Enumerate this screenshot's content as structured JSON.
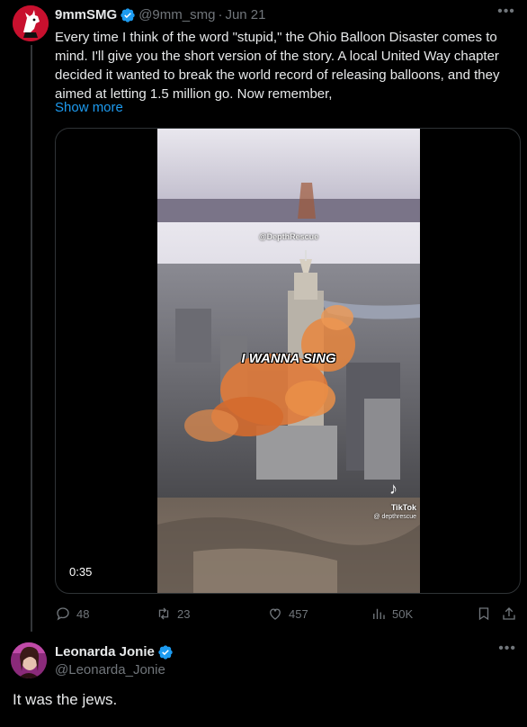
{
  "tweet": {
    "author_name": "9mmSMG",
    "author_handle": "@9mm_smg",
    "separator": "·",
    "date": "Jun 21",
    "text": "Every time I think of the word \"stupid,\" the Ohio Balloon Disaster comes to mind. I'll give you the short version of the story. A local United Way chapter decided it wanted to break the world record of releasing balloons, and they aimed at letting 1.5 million go. Now remember,",
    "show_more": "Show more",
    "more_icon": "•••",
    "video": {
      "watermark": "@DepthRescue",
      "caption": "I WANNA SING",
      "tiktok_label": "TikTok",
      "tiktok_handle": "@ depthrescue",
      "timestamp": "0:35"
    },
    "stats": {
      "replies": "48",
      "retweets": "23",
      "likes": "457",
      "views": "50K"
    },
    "icons": {
      "reply": "reply-icon",
      "retweet": "retweet-icon",
      "like": "heart-icon",
      "views": "views-icon",
      "bookmark": "bookmark-icon",
      "share": "share-icon",
      "verified": "verified-badge-icon"
    }
  },
  "reply": {
    "author_name": "Leonarda Jonie",
    "author_handle": "@Leonarda_Jonie",
    "more_icon": "•••",
    "text": "It was the jews."
  },
  "colors": {
    "background": "#000000",
    "text": "#e7e9ea",
    "muted": "#71767b",
    "accent": "#1d9bf0",
    "verified": "#1d9bf0"
  }
}
